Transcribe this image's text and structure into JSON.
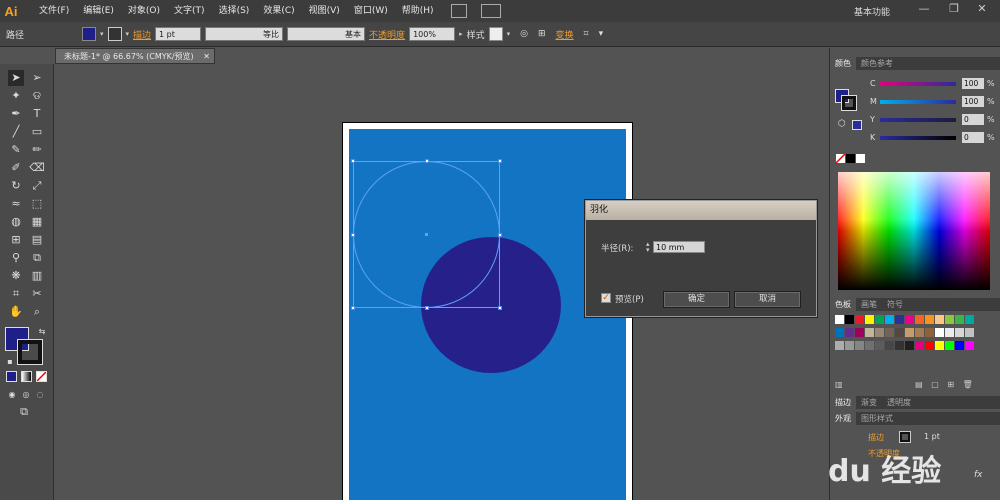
{
  "app": {
    "logo": "Ai",
    "workspace": "基本功能"
  },
  "menubar": [
    "文件(F)",
    "编辑(E)",
    "对象(O)",
    "文字(T)",
    "选择(S)",
    "效果(C)",
    "视图(V)",
    "窗口(W)",
    "帮助(H)"
  ],
  "controlbar": {
    "object_label": "路径",
    "stroke_label": "描边",
    "stroke_weight": "1 pt",
    "line1": "等比",
    "line2": "基本",
    "opacity_label": "不透明度",
    "opacity_value": "100%",
    "style_label": "样式",
    "transform_label": "变换",
    "fill_color": "#1f1f8a"
  },
  "document_tab": "未标题-1* @ 66.67% (CMYK/预览)",
  "artboard": {
    "background": "#1474c4",
    "circle_color": "#25208a"
  },
  "dialog": {
    "title": "羽化",
    "radius_label": "半径(R):",
    "radius_value": "10 mm",
    "preview_label": "预览(P)",
    "preview_checked": "✓",
    "ok_label": "确定",
    "cancel_label": "取消"
  },
  "color_panel": {
    "tabs": [
      "颜色",
      "颜色参考"
    ],
    "sliders": [
      {
        "label": "C",
        "value": "100",
        "pct": "%",
        "color": "#00aeef"
      },
      {
        "label": "M",
        "value": "100",
        "pct": "%",
        "color": "#ec008c"
      },
      {
        "label": "Y",
        "value": "0",
        "pct": "%",
        "color": "#fff200"
      },
      {
        "label": "K",
        "value": "0",
        "pct": "%",
        "color": "#000000"
      }
    ]
  },
  "swatches_panel": {
    "tabs": [
      "色板",
      "画笔",
      "符号"
    ]
  },
  "stroke_panel": {
    "tabs": [
      "描边",
      "渐变",
      "透明度"
    ],
    "sub_tabs": [
      "外观",
      "图形样式"
    ],
    "stroke_label": "描边",
    "stroke_value": "1 pt",
    "opacity_label": "不透明度"
  },
  "watermark": "du 经验"
}
